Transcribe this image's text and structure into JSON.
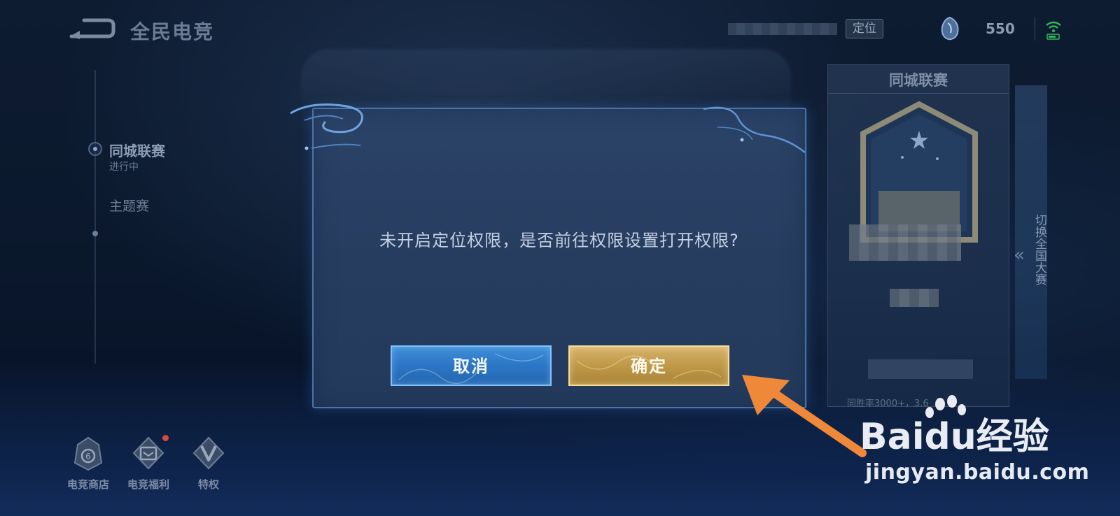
{
  "header": {
    "title": "全民电竞",
    "locate_label": "定位",
    "coin_count": "550",
    "icons": {
      "back": "back-arrow-icon",
      "coin": "gem-currency-icon",
      "signal": "wifi-battery-icon"
    }
  },
  "sidebar": {
    "items": [
      {
        "label": "同城联赛",
        "sub": "进行中",
        "active": true
      },
      {
        "label": "主题赛",
        "active": false
      }
    ]
  },
  "bottom_nav": [
    {
      "label": "电竞商店",
      "icon": "shop-icon"
    },
    {
      "label": "电竞福利",
      "icon": "gift-icon",
      "badge": true
    },
    {
      "label": "特权",
      "icon": "vip-icon"
    }
  ],
  "right_panel": {
    "title": "同城联赛",
    "footer_text": "同胜率3000+，3.6",
    "switch_label": "切换全国大赛",
    "switch_arrows": "«"
  },
  "dialog": {
    "message": "未开启定位权限，是否前往权限设置打开权限?",
    "cancel_label": "取消",
    "confirm_label": "确定"
  },
  "watermark": {
    "brand": "Baidu经验",
    "url": "jingyan.baidu.com"
  },
  "colors": {
    "accent_blue": "#2c76c5",
    "accent_gold": "#c09848",
    "annotation_arrow": "#f0883a",
    "dialog_bg": "#273d60"
  }
}
